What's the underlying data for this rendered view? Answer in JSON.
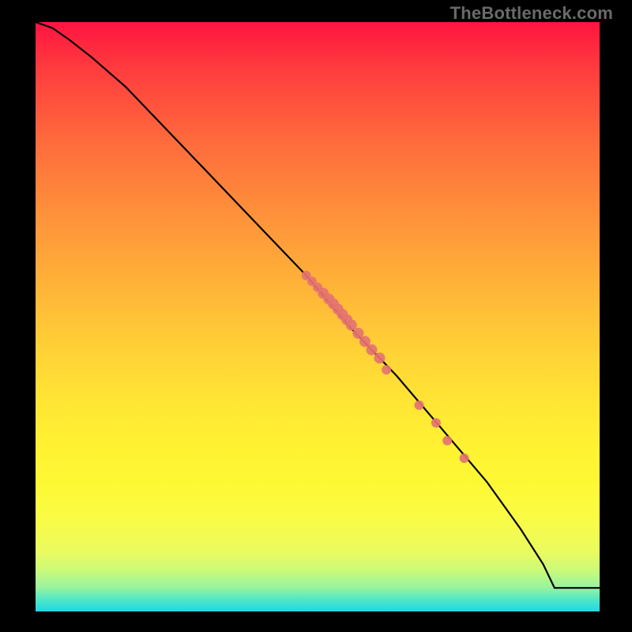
{
  "watermark": "TheBottleneck.com",
  "chart_data": {
    "type": "line",
    "title": "",
    "xlabel": "",
    "ylabel": "",
    "xlim": [
      0,
      100
    ],
    "ylim": [
      0,
      100
    ],
    "grid": false,
    "series": [
      {
        "name": "main-curve",
        "stroke": "#000000",
        "x": [
          0,
          3,
          6,
          10,
          16,
          24,
          32,
          40,
          48,
          56,
          64,
          72,
          80,
          86,
          90,
          92,
          96,
          100
        ],
        "y": [
          100,
          99,
          97,
          94,
          89,
          81,
          73,
          65,
          57,
          48,
          40,
          31,
          22,
          14,
          8,
          4,
          4,
          4
        ]
      }
    ],
    "points": {
      "name": "highlighted-points",
      "fill": "#e57371",
      "x": [
        48,
        49,
        50,
        51,
        52,
        52.8,
        53.6,
        54.4,
        55.2,
        56,
        57.2,
        58.4,
        59.6,
        61,
        62.2,
        68,
        71,
        73,
        76
      ],
      "y": [
        57,
        56,
        55,
        54,
        53,
        52.2,
        51.3,
        50.4,
        49.5,
        48.6,
        47.2,
        45.8,
        44.4,
        43,
        41,
        35,
        32,
        29,
        26
      ],
      "r": [
        6,
        6,
        6,
        7,
        7,
        7,
        7,
        7,
        7,
        7,
        7,
        7,
        7,
        7,
        6,
        6,
        6,
        6,
        6
      ]
    }
  }
}
